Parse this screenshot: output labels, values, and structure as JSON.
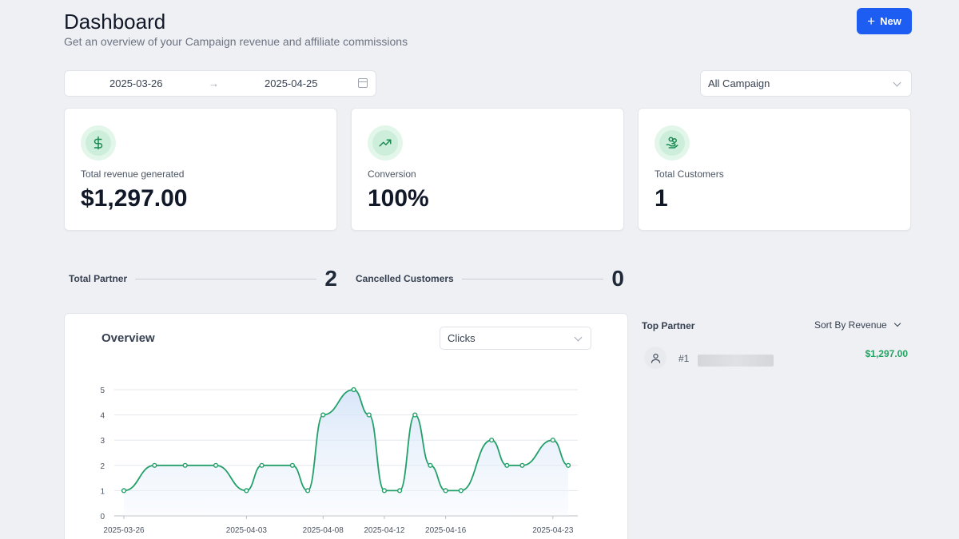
{
  "header": {
    "title": "Dashboard",
    "subtitle": "Get an overview of your Campaign revenue and affiliate commissions",
    "new_button_label": "New"
  },
  "filters": {
    "date_start": "2025-03-26",
    "date_end": "2025-04-25",
    "campaign_selected": "All Campaign"
  },
  "stats": [
    {
      "label": "Total revenue generated",
      "value": "$1,297.00",
      "icon": "dollar-icon"
    },
    {
      "label": "Conversion",
      "value": "100%",
      "icon": "trending-up-icon"
    },
    {
      "label": "Total Customers",
      "value": "1",
      "icon": "hand-coins-icon"
    }
  ],
  "summary": {
    "total_partner_label": "Total Partner",
    "total_partner_value": "2",
    "cancelled_label": "Cancelled Customers",
    "cancelled_value": "0"
  },
  "overview": {
    "title": "Overview",
    "metric_selected": "Clicks"
  },
  "top_partner": {
    "title": "Top Partner",
    "sort_label": "Sort By Revenue",
    "partners": [
      {
        "rank": "#1",
        "revenue": "$1,297.00"
      }
    ]
  },
  "colors": {
    "accent": "#1d5df1",
    "line": "#23a06a",
    "revenue_text": "#23a261"
  },
  "chart_data": {
    "type": "area",
    "x": [
      "2025-03-26",
      "2025-03-28",
      "2025-03-30",
      "2025-04-01",
      "2025-04-03",
      "2025-04-04",
      "2025-04-06",
      "2025-04-07",
      "2025-04-08",
      "2025-04-10",
      "2025-04-11",
      "2025-04-12",
      "2025-04-13",
      "2025-04-14",
      "2025-04-15",
      "2025-04-16",
      "2025-04-17",
      "2025-04-19",
      "2025-04-20",
      "2025-04-21",
      "2025-04-23",
      "2025-04-24"
    ],
    "values": [
      1,
      2,
      2,
      2,
      1,
      2,
      2,
      1,
      4,
      5,
      4,
      1,
      1,
      4,
      2,
      1,
      1,
      3,
      2,
      2,
      3,
      2
    ],
    "tick_labels": [
      "2025-03-26",
      "2025-04-03",
      "2025-04-08",
      "2025-04-12",
      "2025-04-16",
      "2025-04-23"
    ],
    "y_ticks": [
      "0",
      "1",
      "2",
      "3",
      "4",
      "5"
    ],
    "ylim": [
      0,
      5
    ],
    "grid": true
  }
}
